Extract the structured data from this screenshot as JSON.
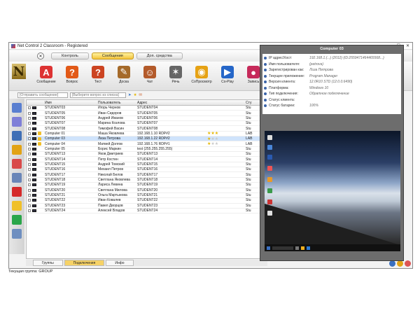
{
  "window": {
    "title": "Net Control 2 Classroom - Registered"
  },
  "tabs": [
    "Контроль",
    "Сообщения",
    "Доп. средства"
  ],
  "active_tab": 1,
  "toolbar": [
    {
      "label": "Сообщение",
      "icon": "message-icon",
      "color": "#d33"
    },
    {
      "label": "Вопрос",
      "icon": "question-icon",
      "color": "#e25a18"
    },
    {
      "label": "Тест",
      "icon": "test-icon",
      "color": "#c42"
    },
    {
      "label": "Доска",
      "icon": "board-icon",
      "color": "#a56a2a"
    },
    {
      "label": "Чат",
      "icon": "chat-icon",
      "color": "#b35a2a"
    },
    {
      "label": "Речь",
      "icon": "microphone-icon",
      "color": "#666"
    },
    {
      "label": "СоПросмотр",
      "icon": "coview-icon",
      "color": "#e6a214"
    },
    {
      "label": "Co-Play",
      "icon": "play-icon",
      "color": "#2566c8"
    },
    {
      "label": "Запись",
      "icon": "record-icon",
      "color": "#c62a5a"
    }
  ],
  "combos": {
    "message": "[Отправить сообщение]",
    "question": "[Выберите вопрос из списка]"
  },
  "table": {
    "headers": [
      "Имя",
      "Пользователь",
      "Адрес",
      "",
      "Сту"
    ],
    "rows": [
      {
        "name": "STUDENT03",
        "user": "Игорь Чернов",
        "addr": "STUDENT04",
        "extra": "Stu"
      },
      {
        "name": "STUDENT05",
        "user": "Иван Сидоров",
        "addr": "STUDENT05",
        "extra": "Stu"
      },
      {
        "name": "STUDENT06",
        "user": "Андрей Иванов",
        "addr": "STUDENT06",
        "extra": "Stu"
      },
      {
        "name": "STUDENT07",
        "user": "Марина Козлова",
        "addr": "STUDENT07",
        "extra": "Stu"
      },
      {
        "name": "STUDENT08",
        "user": "Тимофей Васин",
        "addr": "STUDENT08",
        "extra": "Stu"
      },
      {
        "name": "Computer 01",
        "user": "Маша Яковлева",
        "addr": "192.168.1.10 RDP#2",
        "extra": "LAB",
        "stars": 3,
        "hand": true
      },
      {
        "name": "Computer 03",
        "user": "Лиза Петрова",
        "addr": "192.168.1.22 RDP#2",
        "extra": "LAB",
        "stars": 1,
        "hand": true,
        "sel": true
      },
      {
        "name": "Computer 04",
        "user": "Матвей Долгов",
        "addr": "192.168.1.76 RDP#1",
        "extra": "LAB",
        "stars": 1,
        "hand": true
      },
      {
        "name": "Computer 05",
        "user": "Борис Маркин",
        "addr": "test (255.255.255.255)",
        "extra": "Stu"
      },
      {
        "name": "STUDENT13",
        "user": "Яков Дмитриев",
        "addr": "STUDENT13",
        "extra": "Stu"
      },
      {
        "name": "STUDENT14",
        "user": "Петр Костин",
        "addr": "STUDENT14",
        "extra": "Stu"
      },
      {
        "name": "STUDENT15",
        "user": "Андрей Томский",
        "addr": "STUDENT15",
        "extra": "Stu"
      },
      {
        "name": "STUDENT16",
        "user": "Михаил Петров",
        "addr": "STUDENT16",
        "extra": "Stu"
      },
      {
        "name": "STUDENT17",
        "user": "Николай Белов",
        "addr": "STUDENT17",
        "extra": "Stu"
      },
      {
        "name": "STUDENT18",
        "user": "Светлана Яковлева",
        "addr": "STUDENT18",
        "extra": "Stu"
      },
      {
        "name": "STUDENT19",
        "user": "Лариса Левина",
        "addr": "STUDENT19",
        "extra": "Stu"
      },
      {
        "name": "STUDENT20",
        "user": "Светлана Милова",
        "addr": "STUDENT20",
        "extra": "Stu"
      },
      {
        "name": "STUDENT21",
        "user": "Ольга Мартынова",
        "addr": "STUDENT21",
        "extra": "Stu"
      },
      {
        "name": "STUDENT22",
        "user": "Иван Ковалев",
        "addr": "STUDENT22",
        "extra": "Stu"
      },
      {
        "name": "STUDENT23",
        "user": "Павел Дворцов",
        "addr": "STUDENT23",
        "extra": "Stu"
      },
      {
        "name": "STUDENT24",
        "user": "Алексей Владов",
        "addr": "STUDENT24",
        "extra": "Stu"
      }
    ]
  },
  "bottom_tabs": [
    "Группы",
    "Подключения",
    "Инфо"
  ],
  "bottom_active": 1,
  "status": "Текущая группа: GROUP",
  "panel": {
    "title": "Computer 03",
    "info": [
      {
        "k": "IP адрес/Хост:",
        "v": "192.168.1.(...) (2012) (ID:2559471464465568...)"
      },
      {
        "k": "Имя пользователя:",
        "v": "(petrova)"
      },
      {
        "k": "Зарегистрирован как:",
        "v": "Лиза Петрова"
      },
      {
        "k": "Текущее приложение:",
        "v": "Program Manager"
      },
      {
        "k": "Версия клиента:",
        "v": "12.0R10 STD (12.0.0.6490)"
      },
      {
        "k": "Платформа:",
        "v": "Windows 10"
      },
      {
        "k": "Тип подключения:",
        "v": "Обратное подключение"
      },
      {
        "k": "Статус клиента:",
        "v": ""
      },
      {
        "k": "Статус батареи:",
        "v": "100%"
      }
    ]
  }
}
